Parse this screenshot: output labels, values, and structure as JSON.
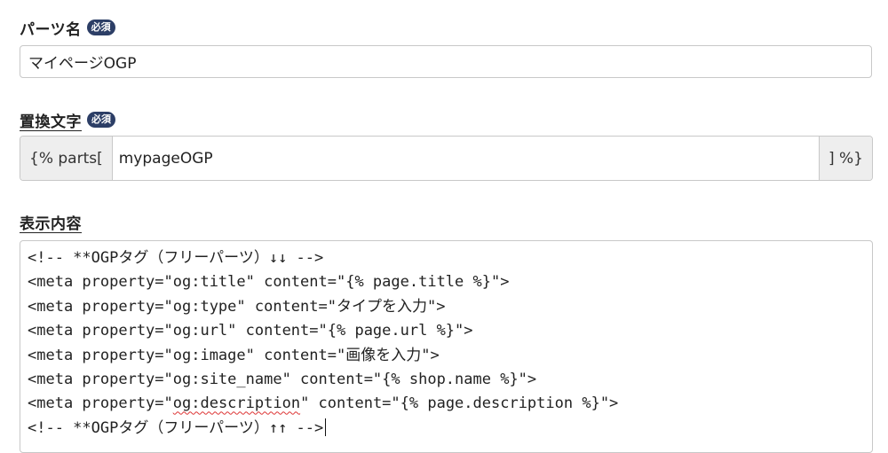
{
  "fields": {
    "parts_name": {
      "label": "パーツ名",
      "badge": "必須",
      "value": "マイページOGP"
    },
    "replace_text": {
      "label": "置換文字",
      "badge": "必須",
      "prefix": "{% parts[",
      "value": "mypageOGP",
      "suffix": "] %}"
    },
    "display_content": {
      "label": "表示内容",
      "lines": [
        "<!-- **OGPタグ（フリーパーツ）↓↓ -->",
        "<meta property=\"og:title\" content=\"{% page.title %}\">",
        "<meta property=\"og:type\" content=\"タイプを入力\">",
        "<meta property=\"og:url\" content=\"{% page.url %}\">",
        "<meta property=\"og:image\" content=\"画像を入力\">",
        "<meta property=\"og:site_name\" content=\"{% shop.name %}\">",
        "<meta property=\"og:description\" content=\"{% page.description %}\">",
        "<!-- **OGPタグ（フリーパーツ）↑↑ -->"
      ],
      "line7_parts": {
        "before": "<meta property=\"",
        "flagged": "og:description",
        "after": "\" content=\"{% page.description %}\">"
      }
    }
  },
  "colors": {
    "badge_bg": "#2c3e66",
    "border": "#c8c8c8",
    "addon_bg": "#eeeeee",
    "spellcheck": "#d33333"
  }
}
